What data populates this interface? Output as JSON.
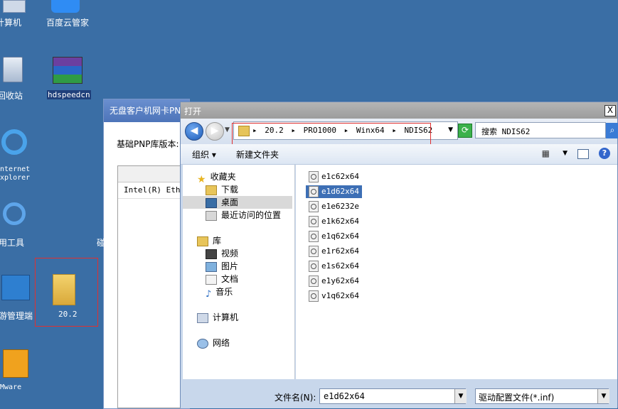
{
  "desktop": {
    "icons": [
      {
        "label": "计算机"
      },
      {
        "label": "百度云管家"
      },
      {
        "label": "回收站"
      },
      {
        "label": "hdspeedcn"
      },
      {
        "label": "Internet Explorer"
      },
      {
        "label": "常用工具"
      },
      {
        "label": "网游管理端"
      },
      {
        "label": "20.2"
      },
      {
        "label": "VMware"
      }
    ]
  },
  "bg_window": {
    "title": "无盘客户机网卡PNP",
    "version_label": "基础PNP库版本:",
    "row1": "Intel(R) Ethe",
    "side_char": "碰"
  },
  "dialog": {
    "title": "打开",
    "close": "X",
    "address": {
      "crumbs": [
        "20.2",
        "PRO1000",
        "Winx64",
        "NDIS62"
      ]
    },
    "search_placeholder": "搜索 NDIS62",
    "toolbar": {
      "organize": "组织",
      "new_folder": "新建文件夹"
    },
    "nav": {
      "favorites": "收藏夹",
      "downloads": "下载",
      "desktop": "桌面",
      "recent": "最近访问的位置",
      "library": "库",
      "videos": "视频",
      "pictures": "图片",
      "documents": "文档",
      "music": "音乐",
      "computer": "计算机",
      "network": "网络"
    },
    "files": [
      "e1c62x64",
      "e1d62x64",
      "e1e6232e",
      "e1k62x64",
      "e1q62x64",
      "e1r62x64",
      "e1s62x64",
      "e1y62x64",
      "v1q62x64"
    ],
    "selected_file": "e1d62x64",
    "bottom": {
      "filename_label": "文件名(N):",
      "filename_value": "e1d62x64",
      "filetype_value": "驱动配置文件(*.inf)"
    }
  }
}
